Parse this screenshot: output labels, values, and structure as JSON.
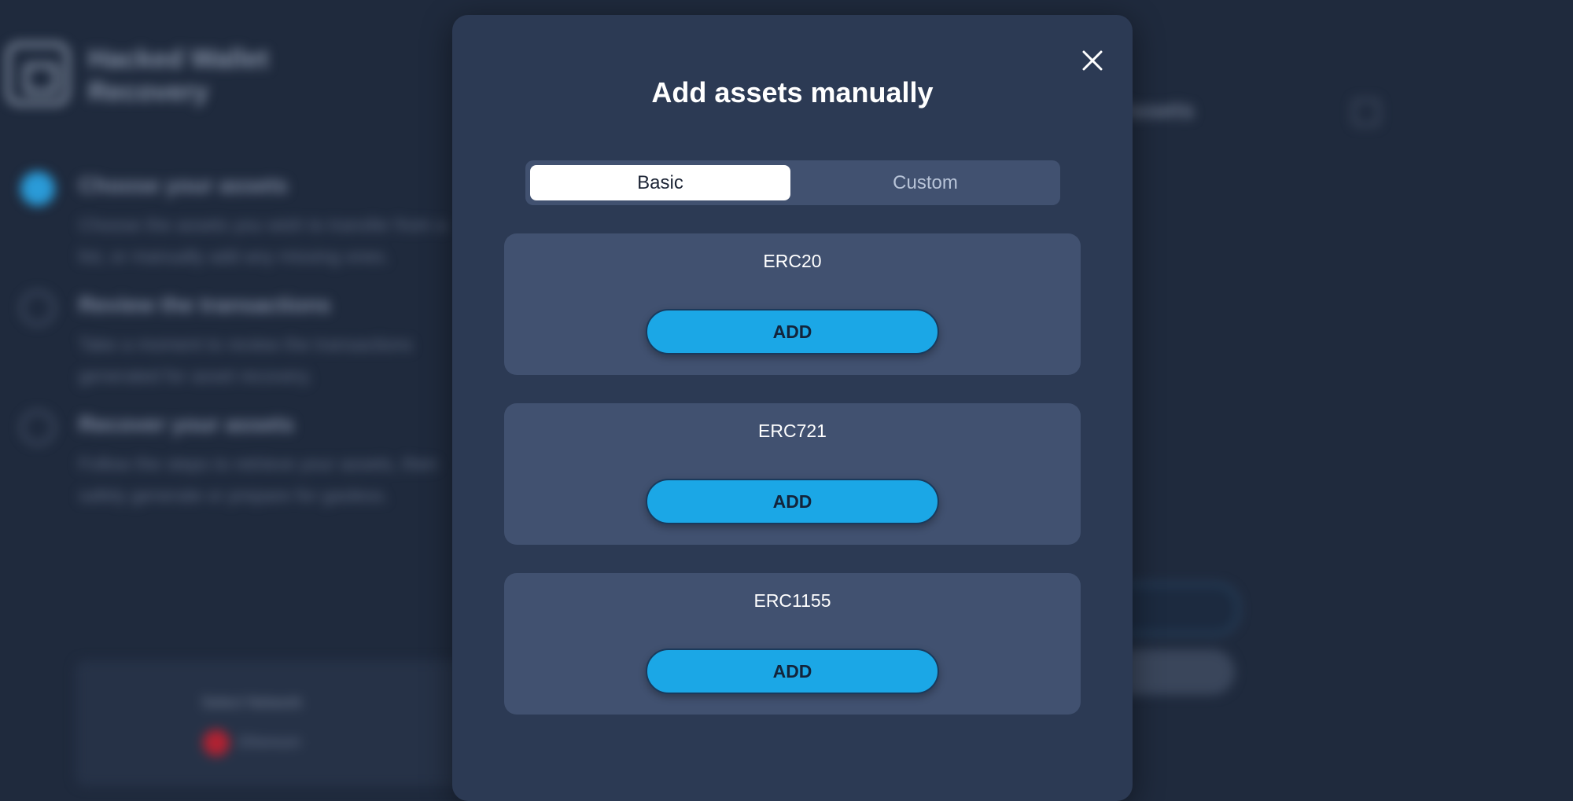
{
  "background": {
    "app_title": "Hacked Wallet Recovery",
    "steps": [
      {
        "title": "Choose your assets",
        "description": "Choose the assets you wish to transfer from a list, or manually add any missing ones."
      },
      {
        "title": "Review the transactions",
        "description": "Take a moment to review the transactions generated for asset recovery."
      },
      {
        "title": "Recover your assets",
        "description": "Follow the steps to retrieve your assets, then safely generate or prepare for gasless."
      }
    ],
    "network_label": "Select Network",
    "network_value": "Ethereum",
    "right_heading": "Assets"
  },
  "modal": {
    "title": "Add assets manually",
    "close_icon": "close-icon",
    "tabs": {
      "basic": "Basic",
      "custom": "Custom",
      "selected": "Basic"
    },
    "assets": [
      {
        "name": "ERC20",
        "button": "ADD"
      },
      {
        "name": "ERC721",
        "button": "ADD"
      },
      {
        "name": "ERC1155",
        "button": "ADD"
      }
    ]
  },
  "colors": {
    "modal_bg": "#2c3a54",
    "card_bg": "#415170",
    "accent": "#1ba7e6",
    "selected_tab_bg": "#ffffff"
  }
}
